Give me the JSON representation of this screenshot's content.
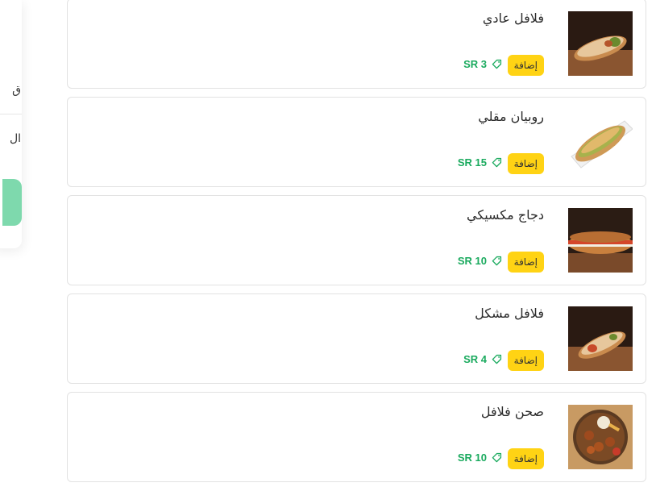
{
  "sidebar": {
    "items": [
      {
        "label": "ق"
      },
      {
        "label": "ال"
      }
    ]
  },
  "items": [
    {
      "name": "فلافل عادي",
      "add_label": "إضافة",
      "price": "SR 3",
      "image": "falafel-wrap"
    },
    {
      "name": "روبيان مقلي",
      "add_label": "إضافة",
      "price": "SR 15",
      "image": "shrimp-sandwich"
    },
    {
      "name": "دجاج مكسيكي",
      "add_label": "إضافة",
      "price": "SR 10",
      "image": "mexican-chicken-sandwich"
    },
    {
      "name": "فلافل مشكل",
      "add_label": "إضافة",
      "price": "SR 4",
      "image": "mixed-falafel-wrap"
    },
    {
      "name": "صحن فلافل",
      "add_label": "إضافة",
      "price": "SR 10",
      "image": "falafel-plate"
    }
  ],
  "colors": {
    "accent_yellow": "#ffd314",
    "price_green": "#1aaa5e",
    "sidebar_button": "#7ed9ad"
  }
}
